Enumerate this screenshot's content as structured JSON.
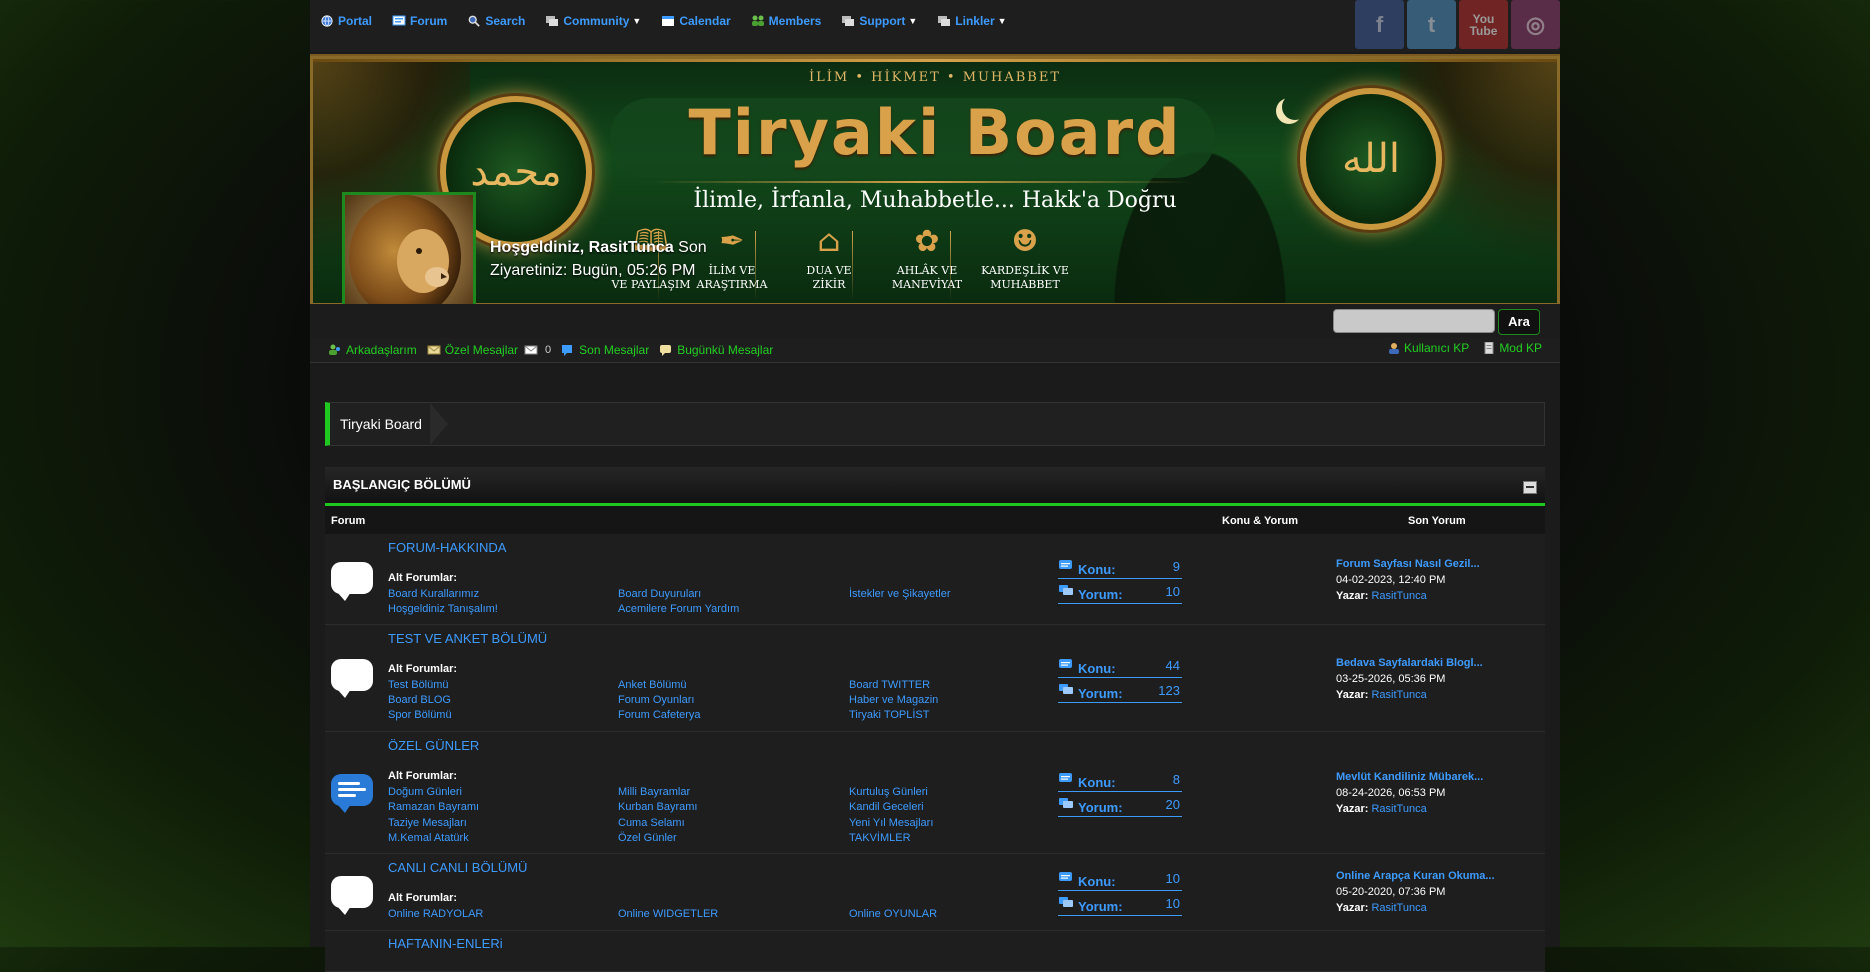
{
  "nav": {
    "items": [
      {
        "label": "Portal",
        "caret": false
      },
      {
        "label": "Forum",
        "caret": false
      },
      {
        "label": "Search",
        "caret": false
      },
      {
        "label": "Community",
        "caret": true
      },
      {
        "label": "Calendar",
        "caret": false
      },
      {
        "label": "Members",
        "caret": false
      },
      {
        "label": "Support",
        "caret": true
      },
      {
        "label": "Linkler",
        "caret": true
      }
    ]
  },
  "social": {
    "facebook": "f",
    "twitter": "t",
    "youtube_1": "You",
    "youtube_2": "Tube",
    "instagram": "◎"
  },
  "banner": {
    "tagline_top": "İLİM • HİKMET • MUHABBET",
    "title": "Tiryaki Board",
    "subtitle": "İlimle, İrfanla, Muhabbetle... Hakk'a Doğru",
    "medal_left": "محمد",
    "medal_right": "الله",
    "categories": [
      {
        "line1": "",
        "line2": "VE PAYLAŞIM"
      },
      {
        "line1": "İLİM VE",
        "line2": "ARAŞTIRMA"
      },
      {
        "line1": "DUA VE",
        "line2": "ZİKİR"
      },
      {
        "line1": "AHLÂK VE",
        "line2": "MANEVİYAT"
      },
      {
        "line1": "KARDEŞLİK VE",
        "line2": "MUHABBET"
      }
    ]
  },
  "welcome": {
    "greeting": "Hoşgeldiniz, RasitTunca",
    "rest": " Son Ziyaretiniz: Bugün, 05:26 PM"
  },
  "search": {
    "button": "Ara",
    "placeholder": ""
  },
  "userlinks": {
    "friends": "Arkadaşlarım",
    "pm": "Özel Mesajlar",
    "pm_count": "0",
    "recent": "Son Mesajlar",
    "today": "Bugünkü Mesajlar",
    "ucp": "Kullanıcı KP",
    "mcp": "Mod KP"
  },
  "breadcrumb": "Tiryaki Board",
  "section": {
    "title": "BAŞLANGIÇ BÖLÜMÜ",
    "col_forum": "Forum",
    "col_topics": "Konu & Yorum",
    "col_last": "Son Yorum"
  },
  "labels": {
    "subforums": "Alt Forumlar",
    "topics": "Konu:",
    "posts": "Yorum:",
    "author": "Yazar:"
  },
  "forums": [
    {
      "name": "FORUM-HAKKINDA",
      "subs": [
        "Board Kurallarımız",
        "Board Duyuruları",
        "İstekler ve Şikayetler",
        "Hoşgeldiniz Tanışalım!",
        "Acemilere Forum Yardım"
      ],
      "topics": "9",
      "posts": "10",
      "last_title": "Forum Sayfası Nasıl Gezil...",
      "last_date": "04-02-2023, 12:40 PM",
      "last_author": "RasitTunca"
    },
    {
      "name": "TEST VE ANKET BÖLÜMÜ",
      "subs": [
        "Test Bölümü",
        "Anket Bölümü",
        "Board TWITTER",
        "Board BLOG",
        "Forum Oyunları",
        "Haber ve Magazin",
        "Spor Bölümü",
        "Forum Cafeterya",
        "Tiryaki TOPLİST"
      ],
      "topics": "44",
      "posts": "123",
      "last_title": "Bedava Sayfalardaki Blogl...",
      "last_date": "03-25-2026, 05:36 PM",
      "last_author": "RasitTunca"
    },
    {
      "name": "ÖZEL GÜNLER",
      "subs": [
        "Doğum Günleri",
        "Milli Bayramlar",
        "Kurtuluş Günleri",
        "Ramazan Bayramı",
        "Kurban Bayramı",
        "Kandil Geceleri",
        "Taziye Mesajları",
        "Cuma Selamı",
        "Yeni Yıl Mesajları",
        "M.Kemal Atatürk",
        "Özel Günler",
        "TAKVİMLER"
      ],
      "topics": "8",
      "posts": "20",
      "last_title": "Mevlüt Kandiliniz Mübarek...",
      "last_date": "08-24-2026, 06:53 PM",
      "last_author": "RasitTunca"
    },
    {
      "name": "CANLI CANLI BÖLÜMÜ",
      "subs": [
        "Online RADYOLAR",
        "Online WIDGETLER",
        "Online OYUNLAR"
      ],
      "topics": "10",
      "posts": "10",
      "last_title": "Online Arapça Kuran Okuma...",
      "last_date": "05-20-2020, 07:36 PM",
      "last_author": "RasitTunca"
    },
    {
      "name": "HAFTANIN-ENLERi"
    }
  ]
}
